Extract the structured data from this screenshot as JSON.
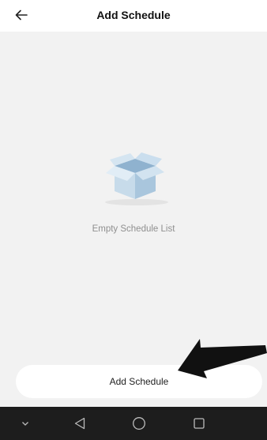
{
  "header": {
    "title": "Add Schedule"
  },
  "empty_state": {
    "message": "Empty Schedule List"
  },
  "actions": {
    "add_label": "Add Schedule"
  },
  "icons": {
    "back": "arrow-left-icon",
    "empty": "open-box-icon",
    "nav_hide": "chevron-down-icon",
    "nav_back": "triangle-back-icon",
    "nav_home": "circle-home-icon",
    "nav_recents": "square-recents-icon"
  },
  "colors": {
    "background": "#f2f2f2",
    "surface": "#ffffff",
    "muted_text": "#8f8f8f",
    "navbar": "#1d1d1d",
    "box_blue": "#bcd4e6"
  }
}
